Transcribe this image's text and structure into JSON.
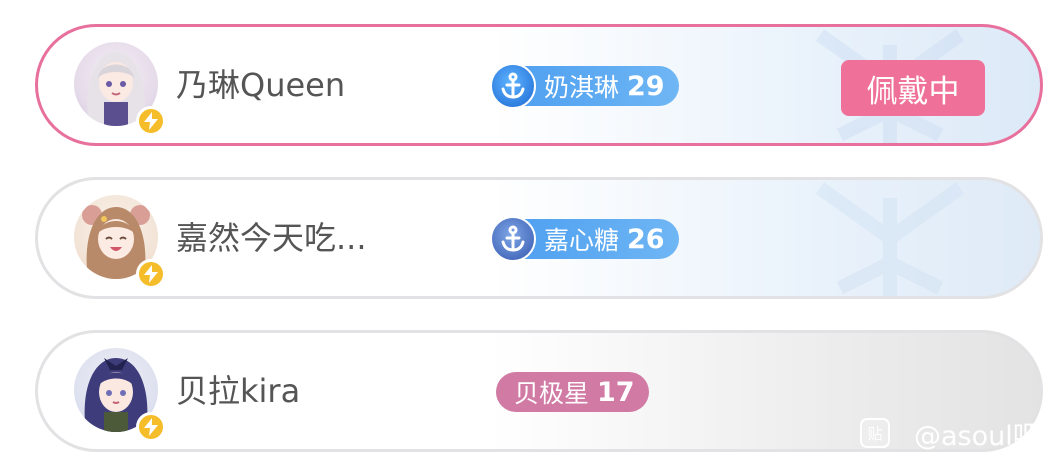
{
  "fans": [
    {
      "user_name": "乃琳Queen",
      "medal_name": "奶淇琳",
      "medal_level": "29",
      "medal_style": "blue",
      "wearing": true,
      "wearing_label": "佩戴中",
      "avatar": "avatar-nailin"
    },
    {
      "user_name": "嘉然今天吃...",
      "medal_name": "嘉心糖",
      "medal_level": "26",
      "medal_style": "blue",
      "wearing": false,
      "avatar": "avatar-jiaran"
    },
    {
      "user_name": "贝拉kira",
      "medal_name": "贝极星",
      "medal_level": "17",
      "medal_style": "pink",
      "wearing": false,
      "avatar": "avatar-beila"
    }
  ],
  "icons": {
    "verified": "lightning-bolt-icon",
    "medal": "anchor-icon"
  },
  "footer": {
    "logo_text": "贴",
    "watermark_text": "@asoul吧"
  },
  "colors": {
    "accent_pink": "#ef7099",
    "border_pink": "#e8709c",
    "medal_blue": "#4a9df0",
    "medal_pink": "#d07aa4",
    "verified_yellow": "#f6bd2b"
  }
}
